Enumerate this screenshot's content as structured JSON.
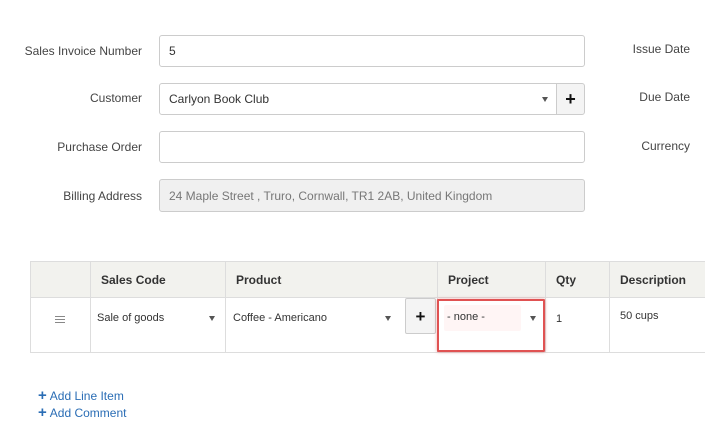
{
  "form": {
    "invoice_number": {
      "label": "Sales Invoice Number",
      "value": "5"
    },
    "customer": {
      "label": "Customer",
      "value": "Carlyon Book Club"
    },
    "purchase_order": {
      "label": "Purchase Order",
      "value": ""
    },
    "billing_address": {
      "label": "Billing Address",
      "value": "24 Maple Street , Truro, Cornwall, TR1 2AB, United Kingdom"
    },
    "right_labels": {
      "issue_date": "Issue Date",
      "due_date": "Due Date",
      "currency": "Currency"
    }
  },
  "table": {
    "headers": {
      "sales_code": "Sales Code",
      "product": "Product",
      "project": "Project",
      "qty": "Qty",
      "description": "Description"
    },
    "row": {
      "sales_code": "Sale of goods",
      "product": "Coffee - Americano",
      "project": "- none -",
      "qty": "1",
      "description": "50 cups"
    }
  },
  "actions": {
    "add_line_item": "Add Line Item",
    "add_comment": "Add Comment"
  },
  "colors": {
    "highlight": "#e05252",
    "link": "#2a6db5",
    "header_bg": "#f2f2ee"
  }
}
